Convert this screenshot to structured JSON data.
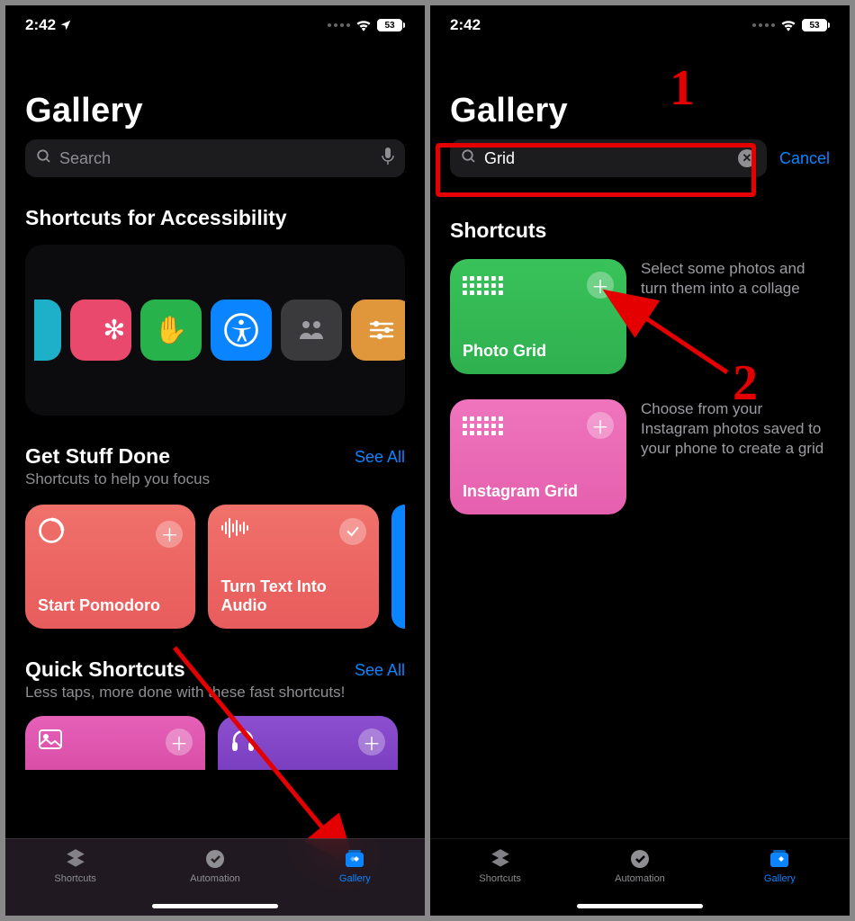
{
  "status": {
    "time": "2:42",
    "battery": "53"
  },
  "left": {
    "title": "Gallery",
    "search_placeholder": "Search",
    "sec1_title": "Shortcuts for Accessibility",
    "sec2_title": "Get Stuff Done",
    "sec2_sub": "Shortcuts to help you focus",
    "sec3_title": "Quick Shortcuts",
    "sec3_sub": "Less taps, more done with these fast shortcuts!",
    "see_all": "See All",
    "cards": {
      "pomodoro": "Start Pomodoro",
      "turn_text": "Turn Text Into Audio"
    }
  },
  "right": {
    "title": "Gallery",
    "search_value": "Grid",
    "cancel": "Cancel",
    "results_title": "Shortcuts",
    "r1_label": "Photo Grid",
    "r1_desc": "Select some photos and turn them into a collage",
    "r2_label": "Instagram Grid",
    "r2_desc": "Choose from your Instagram photos saved to your phone to create a grid"
  },
  "tabs": {
    "shortcuts": "Shortcuts",
    "automation": "Automation",
    "gallery": "Gallery"
  },
  "annot": {
    "n1": "1",
    "n2": "2"
  }
}
